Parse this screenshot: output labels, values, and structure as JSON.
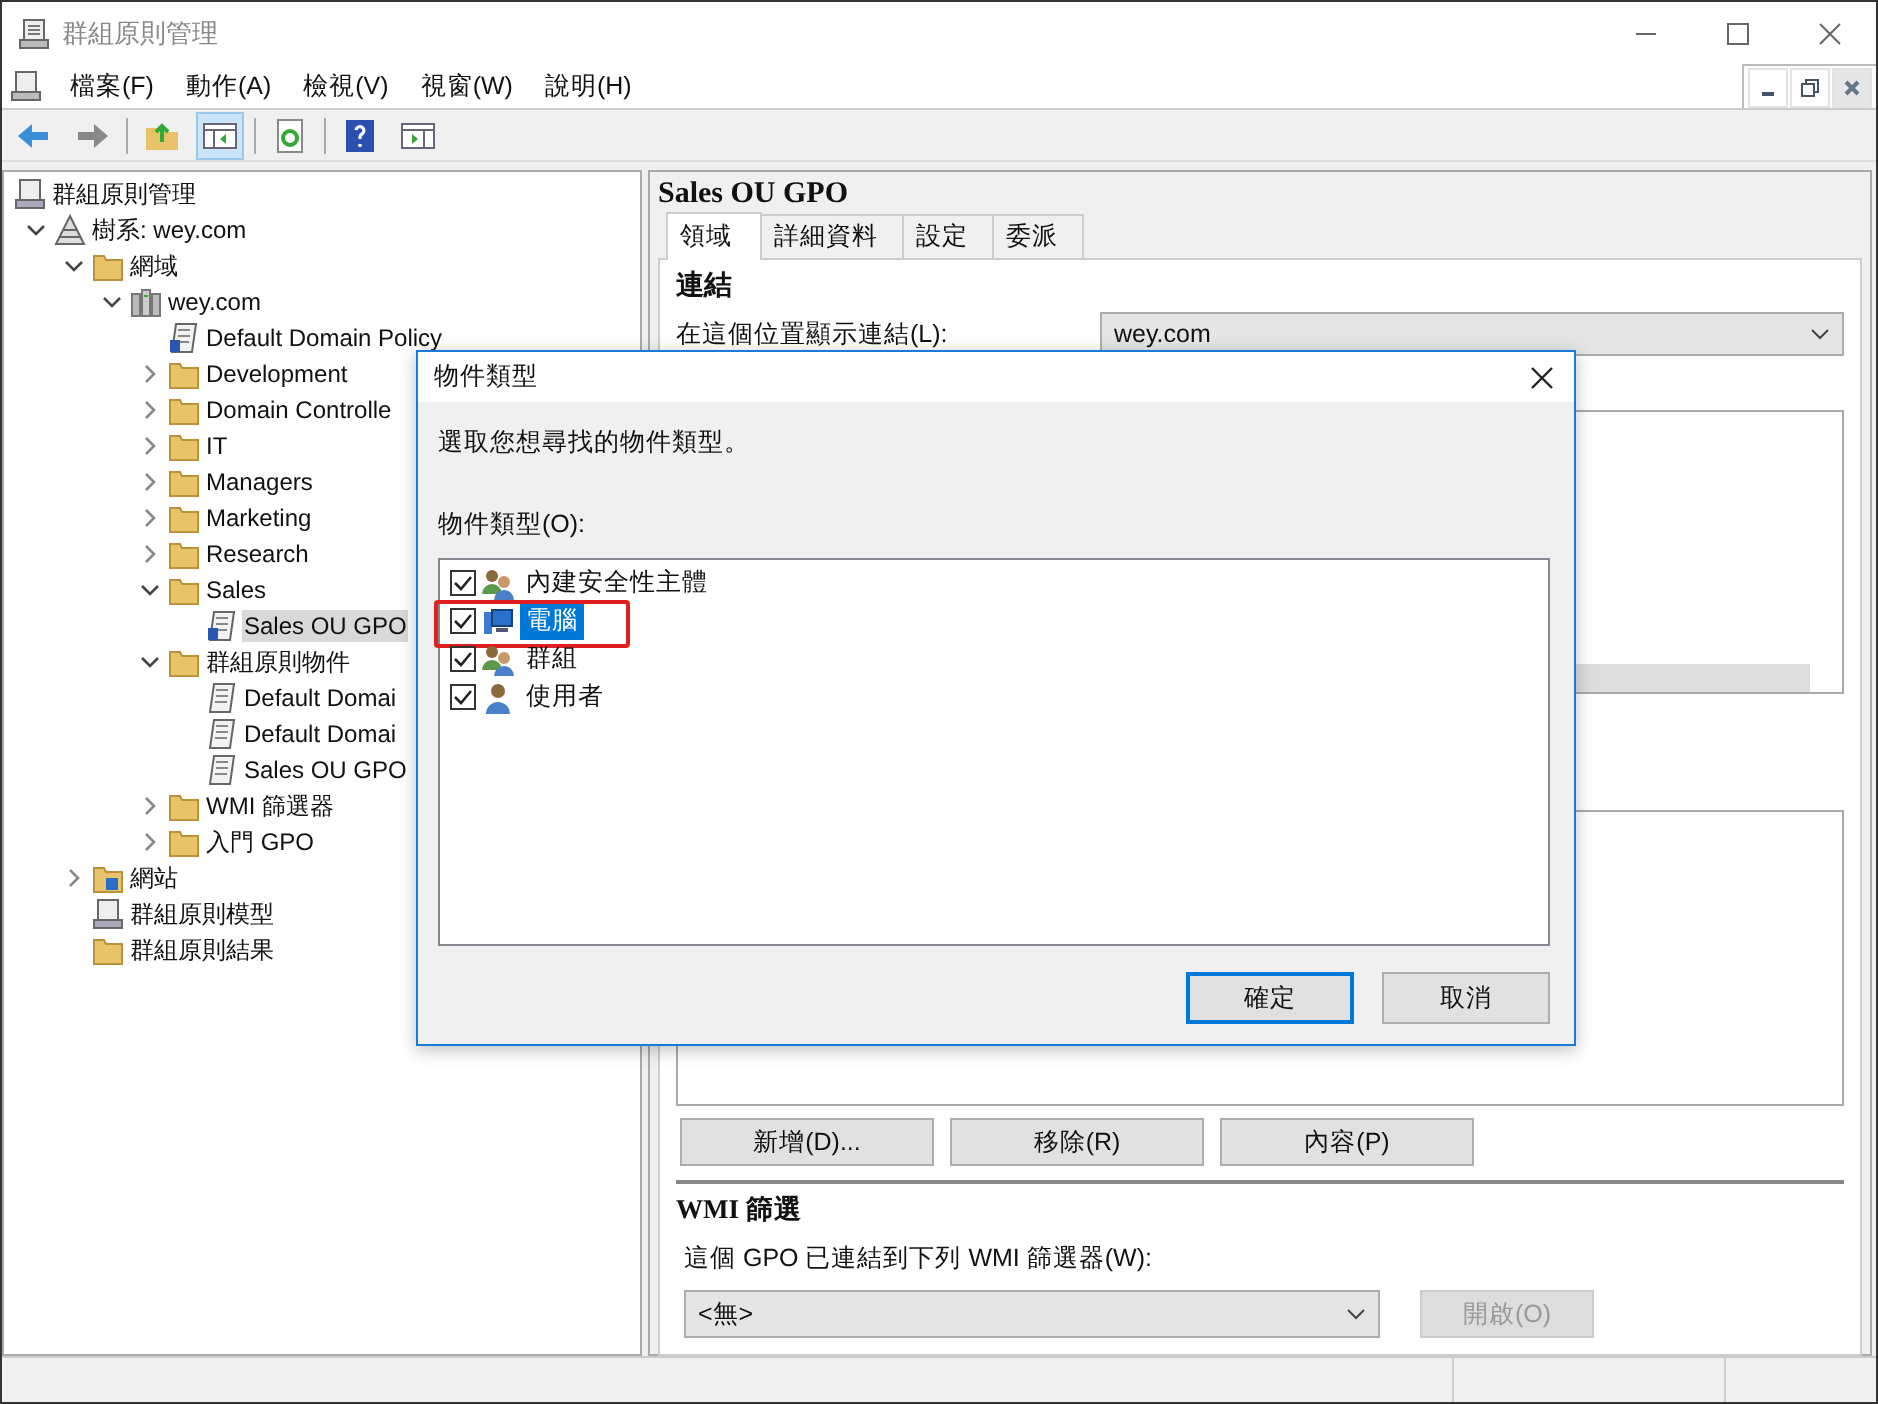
{
  "window": {
    "title": "群組原則管理"
  },
  "menu": [
    "檔案(F)",
    "動作(A)",
    "檢視(V)",
    "視窗(W)",
    "說明(H)"
  ],
  "toolbar": [
    {
      "kind": "back",
      "pressed": false
    },
    {
      "kind": "forward",
      "pressed": false
    },
    {
      "kind": "sep"
    },
    {
      "kind": "up",
      "pressed": false
    },
    {
      "kind": "tree",
      "pressed": true
    },
    {
      "kind": "sep"
    },
    {
      "kind": "refresh",
      "pressed": false
    },
    {
      "kind": "sep"
    },
    {
      "kind": "help",
      "pressed": false
    },
    {
      "kind": "pane",
      "pressed": false
    }
  ],
  "tree": [
    {
      "label": "群組原則管理",
      "kind": "console",
      "selected": false,
      "children": [
        {
          "label": "樹系: wey.com",
          "kind": "forest",
          "expanded": true,
          "selected": false,
          "children": [
            {
              "label": "網域",
              "kind": "domains",
              "expanded": true,
              "selected": false,
              "children": [
                {
                  "label": "wey.com",
                  "kind": "domain",
                  "expanded": true,
                  "selected": false,
                  "children": [
                    {
                      "label": "Default Domain Policy",
                      "kind": "link",
                      "selected": false
                    },
                    {
                      "label": "Development",
                      "kind": "ou",
                      "expanded": false,
                      "selected": false
                    },
                    {
                      "label": "Domain Controlle",
                      "kind": "ou",
                      "expanded": false,
                      "selected": false
                    },
                    {
                      "label": "IT",
                      "kind": "ou",
                      "expanded": false,
                      "selected": false
                    },
                    {
                      "label": "Managers",
                      "kind": "ou",
                      "expanded": false,
                      "selected": false
                    },
                    {
                      "label": "Marketing",
                      "kind": "ou",
                      "expanded": false,
                      "selected": false
                    },
                    {
                      "label": "Research",
                      "kind": "ou",
                      "expanded": false,
                      "selected": false
                    },
                    {
                      "label": "Sales",
                      "kind": "ou",
                      "expanded": true,
                      "selected": false,
                      "children": [
                        {
                          "label": "Sales OU GPO",
                          "kind": "link",
                          "selected": true
                        }
                      ]
                    },
                    {
                      "label": "群組原則物件",
                      "kind": "container",
                      "expanded": true,
                      "selected": false,
                      "children": [
                        {
                          "label": "Default Domai",
                          "kind": "gpo",
                          "selected": false
                        },
                        {
                          "label": "Default Domai",
                          "kind": "gpo",
                          "selected": false
                        },
                        {
                          "label": "Sales OU GPO",
                          "kind": "gpo",
                          "selected": false
                        }
                      ]
                    },
                    {
                      "label": "WMI 篩選器",
                      "kind": "wmi",
                      "expanded": false,
                      "selected": false
                    },
                    {
                      "label": "入門 GPO",
                      "kind": "starter",
                      "expanded": false,
                      "selected": false
                    }
                  ]
                }
              ]
            },
            {
              "label": "網站",
              "kind": "sites",
              "expanded": false,
              "selected": false
            },
            {
              "label": "群組原則模型",
              "kind": "modeling",
              "selected": false
            },
            {
              "label": "群組原則結果",
              "kind": "results",
              "selected": false
            }
          ]
        }
      ]
    }
  ],
  "details": {
    "title": "Sales OU GPO",
    "tabs": [
      {
        "label": "領域",
        "selected": true
      },
      {
        "label": "詳細資料",
        "selected": false
      },
      {
        "label": "設定",
        "selected": false
      },
      {
        "label": "委派",
        "selected": false
      }
    ],
    "links": {
      "heading": "連結",
      "label": "在這個位置顯示連結(L):",
      "location": "wey.com"
    },
    "buttons": [
      "新增(D)...",
      "移除(R)",
      "內容(P)"
    ],
    "wmi": {
      "heading": "WMI 篩選",
      "label": "這個 GPO 已連結到下列 WMI 篩選器(W):",
      "filter": "<無>",
      "open_button": {
        "label": "開啟(O)",
        "disabled": true
      }
    }
  },
  "dialog": {
    "title": "物件類型",
    "prompt": "選取您想尋找的物件類型。",
    "list_label": "物件類型(O):",
    "items": [
      {
        "label": "內建安全性主體",
        "kind": "group",
        "checked": true,
        "selected": false,
        "annotated": false
      },
      {
        "label": "電腦",
        "kind": "computer",
        "checked": true,
        "selected": true,
        "annotated": true
      },
      {
        "label": "群組",
        "kind": "group",
        "checked": true,
        "selected": false,
        "annotated": false
      },
      {
        "label": "使用者",
        "kind": "user",
        "checked": true,
        "selected": false,
        "annotated": false
      }
    ],
    "buttons": [
      {
        "label": "確定",
        "default": true
      },
      {
        "label": "取消",
        "default": false
      }
    ]
  }
}
